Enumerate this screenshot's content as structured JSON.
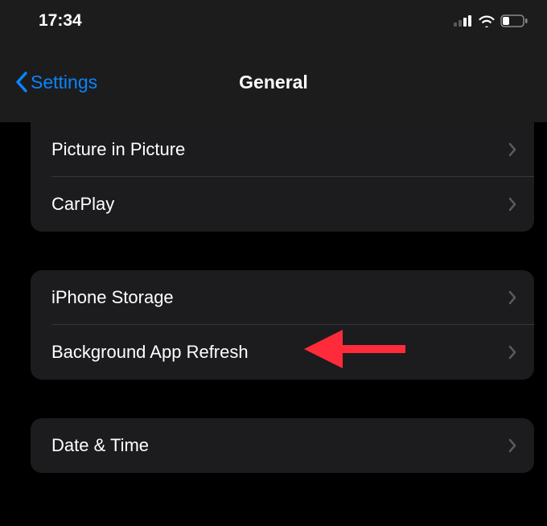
{
  "status": {
    "time": "17:34"
  },
  "nav": {
    "back_label": "Settings",
    "title": "General"
  },
  "groups": [
    {
      "rows": [
        {
          "label": "Picture in Picture"
        },
        {
          "label": "CarPlay"
        }
      ]
    },
    {
      "rows": [
        {
          "label": "iPhone Storage"
        },
        {
          "label": "Background App Refresh"
        }
      ]
    },
    {
      "rows": [
        {
          "label": "Date & Time"
        }
      ]
    }
  ],
  "annotation": {
    "color": "#ff2b3a"
  }
}
